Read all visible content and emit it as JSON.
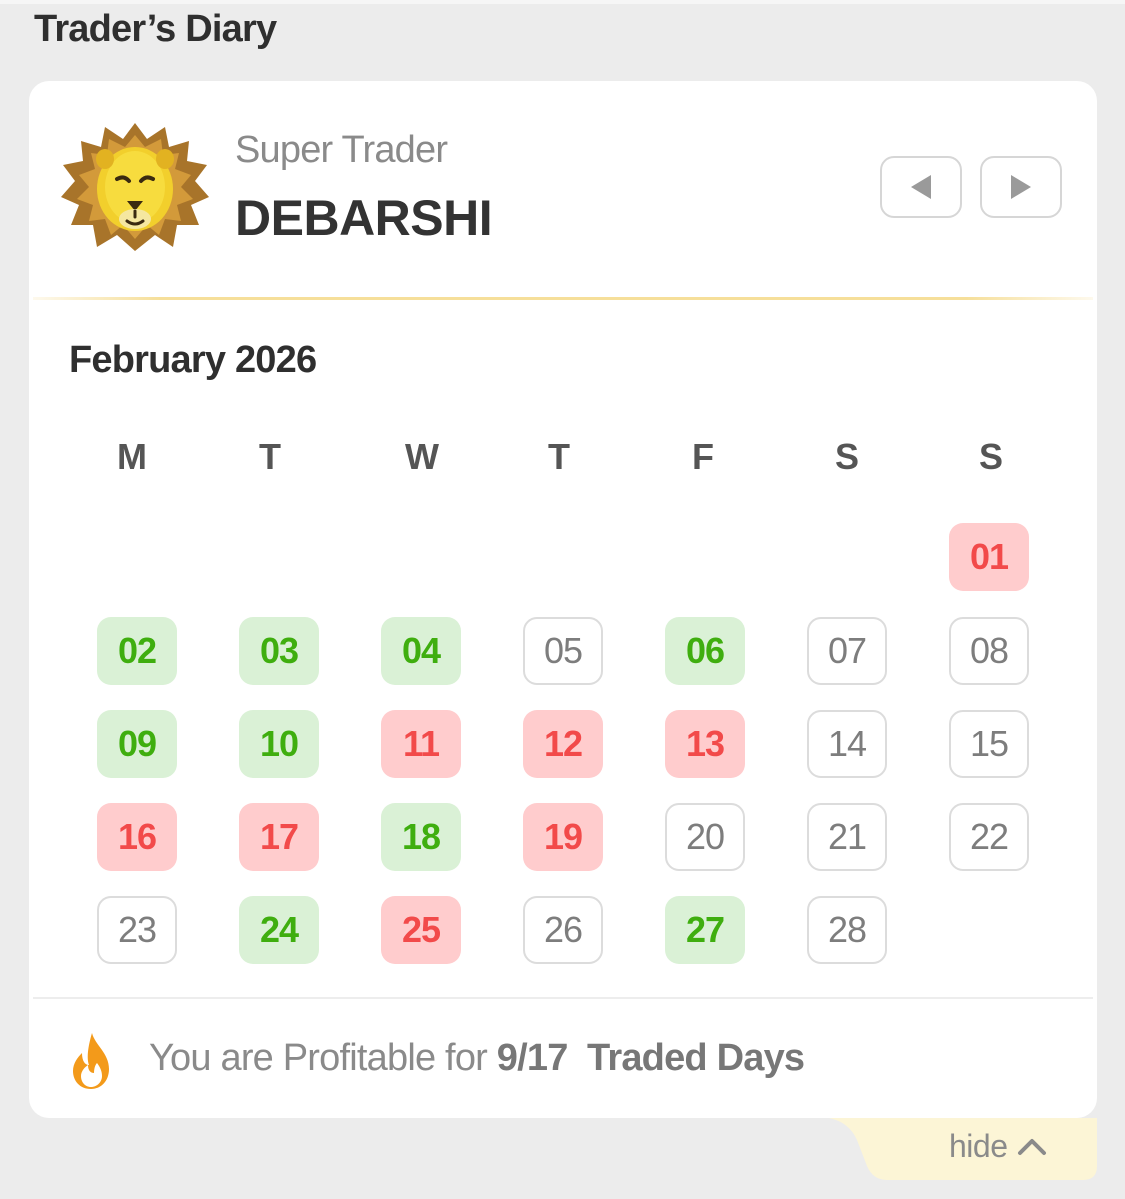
{
  "header": {
    "title": "Trader’s Diary"
  },
  "profile": {
    "level": "Super Trader",
    "name": "DEBARSHI",
    "avatar_icon": "lion-icon"
  },
  "nav": {
    "prev_icon": "triangle-left-icon",
    "next_icon": "triangle-right-icon"
  },
  "calendar": {
    "month_label": "February 2026",
    "weekdays": [
      "M",
      "T",
      "W",
      "T",
      "F",
      "S",
      "S"
    ],
    "days": [
      {
        "label": "01",
        "status": "loss"
      },
      {
        "label": "02",
        "status": "profit"
      },
      {
        "label": "03",
        "status": "profit"
      },
      {
        "label": "04",
        "status": "profit"
      },
      {
        "label": "05",
        "status": "none"
      },
      {
        "label": "06",
        "status": "profit"
      },
      {
        "label": "07",
        "status": "none"
      },
      {
        "label": "08",
        "status": "none"
      },
      {
        "label": "09",
        "status": "profit"
      },
      {
        "label": "10",
        "status": "profit"
      },
      {
        "label": "11",
        "status": "loss"
      },
      {
        "label": "12",
        "status": "loss"
      },
      {
        "label": "13",
        "status": "loss"
      },
      {
        "label": "14",
        "status": "none"
      },
      {
        "label": "15",
        "status": "none"
      },
      {
        "label": "16",
        "status": "loss"
      },
      {
        "label": "17",
        "status": "loss"
      },
      {
        "label": "18",
        "status": "profit"
      },
      {
        "label": "19",
        "status": "loss"
      },
      {
        "label": "20",
        "status": "none"
      },
      {
        "label": "21",
        "status": "none"
      },
      {
        "label": "22",
        "status": "none"
      },
      {
        "label": "23",
        "status": "none"
      },
      {
        "label": "24",
        "status": "profit"
      },
      {
        "label": "25",
        "status": "loss"
      },
      {
        "label": "26",
        "status": "none"
      },
      {
        "label": "27",
        "status": "profit"
      },
      {
        "label": "28",
        "status": "none"
      }
    ]
  },
  "summary": {
    "prefix": "You are Profitable for ",
    "ratio": "9/17",
    "suffix": "Traded Days",
    "icon": "fire-icon"
  },
  "footer": {
    "hide_label": "hide",
    "hide_icon": "chevron-up-icon"
  },
  "colors": {
    "profit_bg": "#daf1d6",
    "profit_text": "#3fae0f",
    "loss_bg": "#ffcccd",
    "loss_text": "#f24a4a",
    "accent_gold": "#f6df9a",
    "fire": "#f39a1a"
  }
}
